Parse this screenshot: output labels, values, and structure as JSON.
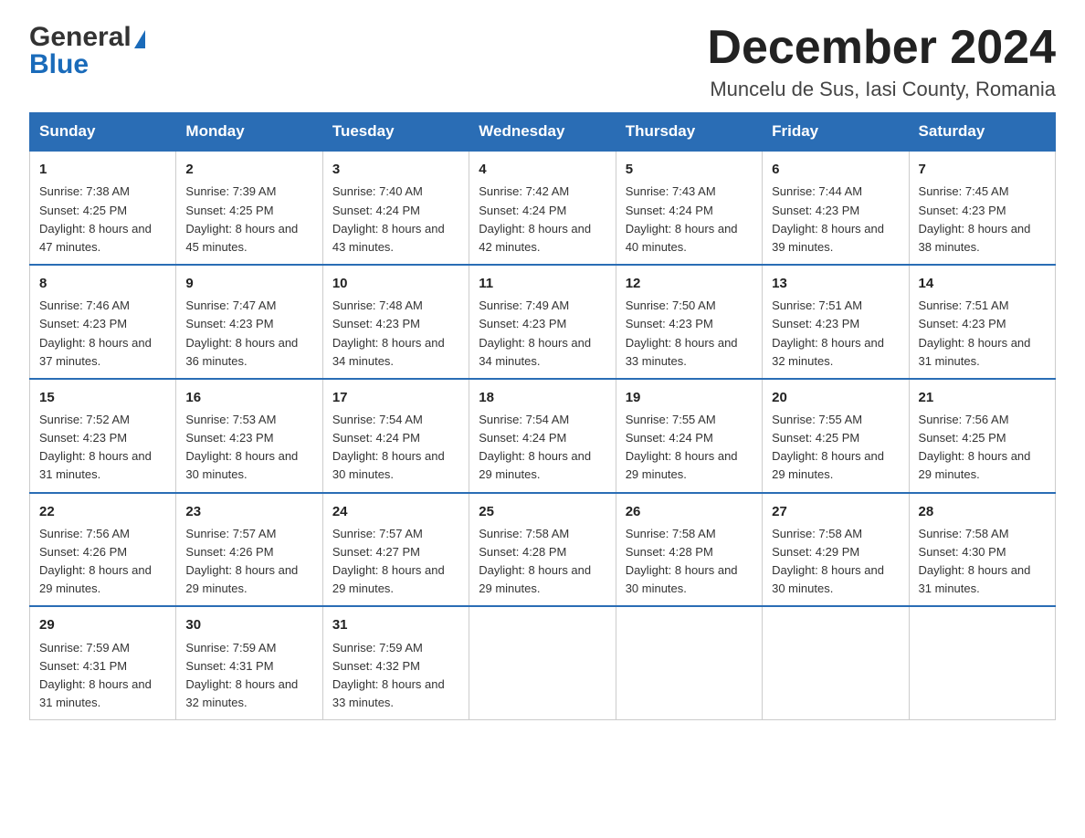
{
  "header": {
    "logo_general": "General",
    "logo_blue": "Blue",
    "title": "December 2024",
    "subtitle": "Muncelu de Sus, Iasi County, Romania"
  },
  "weekdays": [
    "Sunday",
    "Monday",
    "Tuesday",
    "Wednesday",
    "Thursday",
    "Friday",
    "Saturday"
  ],
  "weeks": [
    [
      {
        "day": "1",
        "sunrise": "7:38 AM",
        "sunset": "4:25 PM",
        "daylight": "8 hours and 47 minutes."
      },
      {
        "day": "2",
        "sunrise": "7:39 AM",
        "sunset": "4:25 PM",
        "daylight": "8 hours and 45 minutes."
      },
      {
        "day": "3",
        "sunrise": "7:40 AM",
        "sunset": "4:24 PM",
        "daylight": "8 hours and 43 minutes."
      },
      {
        "day": "4",
        "sunrise": "7:42 AM",
        "sunset": "4:24 PM",
        "daylight": "8 hours and 42 minutes."
      },
      {
        "day": "5",
        "sunrise": "7:43 AM",
        "sunset": "4:24 PM",
        "daylight": "8 hours and 40 minutes."
      },
      {
        "day": "6",
        "sunrise": "7:44 AM",
        "sunset": "4:23 PM",
        "daylight": "8 hours and 39 minutes."
      },
      {
        "day": "7",
        "sunrise": "7:45 AM",
        "sunset": "4:23 PM",
        "daylight": "8 hours and 38 minutes."
      }
    ],
    [
      {
        "day": "8",
        "sunrise": "7:46 AM",
        "sunset": "4:23 PM",
        "daylight": "8 hours and 37 minutes."
      },
      {
        "day": "9",
        "sunrise": "7:47 AM",
        "sunset": "4:23 PM",
        "daylight": "8 hours and 36 minutes."
      },
      {
        "day": "10",
        "sunrise": "7:48 AM",
        "sunset": "4:23 PM",
        "daylight": "8 hours and 34 minutes."
      },
      {
        "day": "11",
        "sunrise": "7:49 AM",
        "sunset": "4:23 PM",
        "daylight": "8 hours and 34 minutes."
      },
      {
        "day": "12",
        "sunrise": "7:50 AM",
        "sunset": "4:23 PM",
        "daylight": "8 hours and 33 minutes."
      },
      {
        "day": "13",
        "sunrise": "7:51 AM",
        "sunset": "4:23 PM",
        "daylight": "8 hours and 32 minutes."
      },
      {
        "day": "14",
        "sunrise": "7:51 AM",
        "sunset": "4:23 PM",
        "daylight": "8 hours and 31 minutes."
      }
    ],
    [
      {
        "day": "15",
        "sunrise": "7:52 AM",
        "sunset": "4:23 PM",
        "daylight": "8 hours and 31 minutes."
      },
      {
        "day": "16",
        "sunrise": "7:53 AM",
        "sunset": "4:23 PM",
        "daylight": "8 hours and 30 minutes."
      },
      {
        "day": "17",
        "sunrise": "7:54 AM",
        "sunset": "4:24 PM",
        "daylight": "8 hours and 30 minutes."
      },
      {
        "day": "18",
        "sunrise": "7:54 AM",
        "sunset": "4:24 PM",
        "daylight": "8 hours and 29 minutes."
      },
      {
        "day": "19",
        "sunrise": "7:55 AM",
        "sunset": "4:24 PM",
        "daylight": "8 hours and 29 minutes."
      },
      {
        "day": "20",
        "sunrise": "7:55 AM",
        "sunset": "4:25 PM",
        "daylight": "8 hours and 29 minutes."
      },
      {
        "day": "21",
        "sunrise": "7:56 AM",
        "sunset": "4:25 PM",
        "daylight": "8 hours and 29 minutes."
      }
    ],
    [
      {
        "day": "22",
        "sunrise": "7:56 AM",
        "sunset": "4:26 PM",
        "daylight": "8 hours and 29 minutes."
      },
      {
        "day": "23",
        "sunrise": "7:57 AM",
        "sunset": "4:26 PM",
        "daylight": "8 hours and 29 minutes."
      },
      {
        "day": "24",
        "sunrise": "7:57 AM",
        "sunset": "4:27 PM",
        "daylight": "8 hours and 29 minutes."
      },
      {
        "day": "25",
        "sunrise": "7:58 AM",
        "sunset": "4:28 PM",
        "daylight": "8 hours and 29 minutes."
      },
      {
        "day": "26",
        "sunrise": "7:58 AM",
        "sunset": "4:28 PM",
        "daylight": "8 hours and 30 minutes."
      },
      {
        "day": "27",
        "sunrise": "7:58 AM",
        "sunset": "4:29 PM",
        "daylight": "8 hours and 30 minutes."
      },
      {
        "day": "28",
        "sunrise": "7:58 AM",
        "sunset": "4:30 PM",
        "daylight": "8 hours and 31 minutes."
      }
    ],
    [
      {
        "day": "29",
        "sunrise": "7:59 AM",
        "sunset": "4:31 PM",
        "daylight": "8 hours and 31 minutes."
      },
      {
        "day": "30",
        "sunrise": "7:59 AM",
        "sunset": "4:31 PM",
        "daylight": "8 hours and 32 minutes."
      },
      {
        "day": "31",
        "sunrise": "7:59 AM",
        "sunset": "4:32 PM",
        "daylight": "8 hours and 33 minutes."
      },
      null,
      null,
      null,
      null
    ]
  ],
  "labels": {
    "sunrise_prefix": "Sunrise: ",
    "sunset_prefix": "Sunset: ",
    "daylight_prefix": "Daylight: "
  }
}
